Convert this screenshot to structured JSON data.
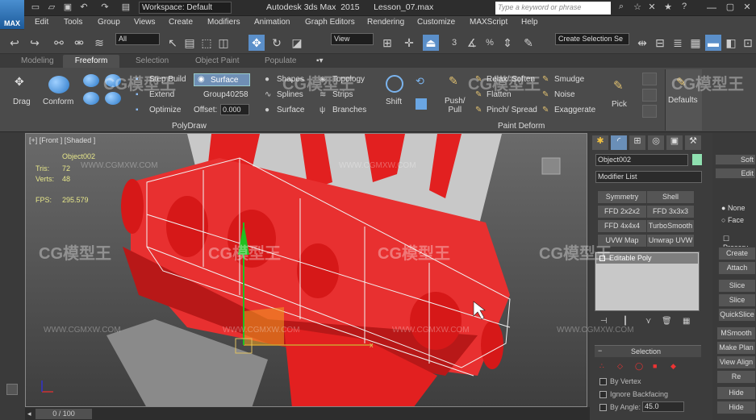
{
  "app": {
    "logo": "MAX",
    "title": "Autodesk 3ds Max  2015      Lesson_07.max",
    "workspace": "Workspace: Default",
    "search_placeholder": "Type a keyword or phrase"
  },
  "menu": [
    "Edit",
    "Tools",
    "Group",
    "Views",
    "Create",
    "Modifiers",
    "Animation",
    "Graph Editors",
    "Rendering",
    "Customize",
    "MAXScript",
    "Help"
  ],
  "toolbar": {
    "selection_filter": "All",
    "ref_coord": "View",
    "named_sel": "Create Selection Se",
    "label_3": "3",
    "label_percent": "%"
  },
  "ribbon_tabs": [
    "Modeling",
    "Freeform",
    "Selection",
    "Object Paint",
    "Populate"
  ],
  "ribbon": {
    "drag": "Drag",
    "conform": "Conform",
    "step_build": "Step Build",
    "extend": "Extend",
    "optimize": "Optimize",
    "surface_btn": "Surface",
    "group": "Group40258",
    "offset_label": "Offset:",
    "offset_value": "0.000",
    "shapes": "Shapes",
    "splines": "Splines",
    "surface": "Surface",
    "topology": "Topology",
    "strips": "Strips",
    "branches": "Branches",
    "polydraw": "PolyDraw",
    "shift": "Shift",
    "push_pull": "Push/\nPull",
    "relax_soften": "Relax/ Soften",
    "flatten": "Flatten",
    "pinch_spread": "Pinch/ Spread",
    "smudge": "Smudge",
    "noise": "Noise",
    "exaggerate": "Exaggerate",
    "pick": "Pick",
    "paint_deform": "Paint Deform",
    "defaults": "Defaults"
  },
  "viewport": {
    "label": "[+] [Front ] [Shaded ]",
    "object": "Object002",
    "tris_label": "Tris:",
    "tris": "72",
    "verts_label": "Verts:",
    "verts": "48",
    "fps_label": "FPS:",
    "fps": "295.579"
  },
  "command_panel": {
    "object_name": "Object002",
    "modifier_list": "Modifier List",
    "buttons": [
      "Symmetry",
      "Shell",
      "FFD 2x2x2",
      "FFD 3x3x3",
      "FFD 4x4x4",
      "TurboSmooth",
      "UVW Map",
      "Unwrap UVW"
    ],
    "stack_item": "Editable Poly",
    "rollout_selection": "Selection",
    "by_vertex": "By Vertex",
    "ignore_backfacing": "Ignore Backfacing",
    "by_angle": "By Angle:",
    "angle_value": "45.0"
  },
  "right_strip": {
    "soft": "Soft",
    "edit": "Edit",
    "none": "None",
    "face": "Face",
    "preserve": "Preserv",
    "create": "Create",
    "attach": "Attach",
    "slice_plane": "Slice Plane",
    "slice": "Slice",
    "quickslice": "QuickSlice",
    "msmooth": "MSmooth",
    "make_planar": "Make Plan",
    "view_align": "View Align",
    "hide_selected": "Hide Selecte",
    "re": "Re",
    "hide": "Hide"
  },
  "timeline": {
    "slider": "0 / 100"
  },
  "watermark": {
    "logo": "CG模型王",
    "url": "WWW.CGMXW.COM"
  }
}
